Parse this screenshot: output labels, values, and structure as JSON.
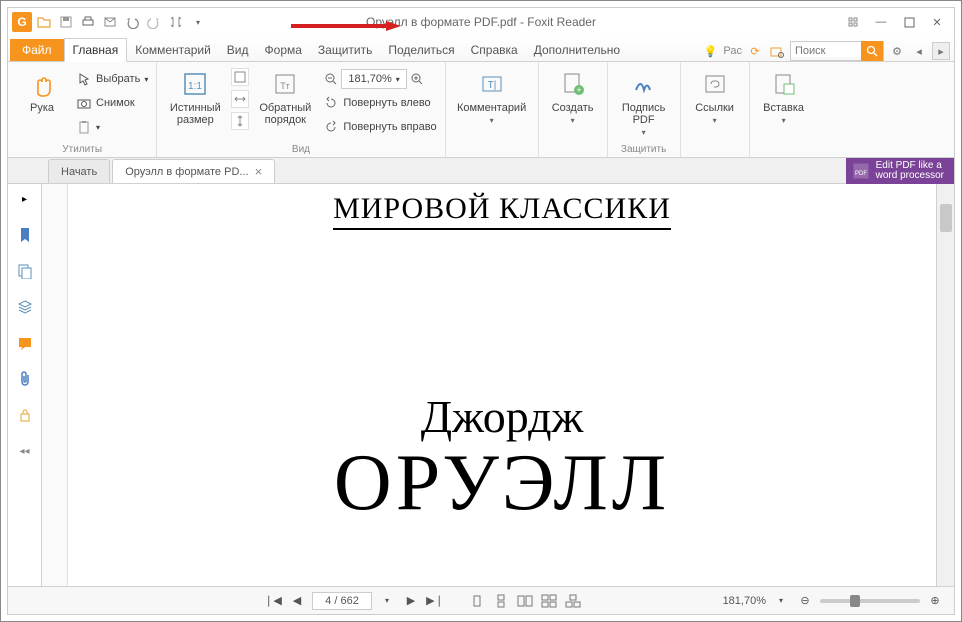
{
  "title": "Оруэлл в формате PDF.pdf - Foxit Reader",
  "qat": {
    "logo": "G"
  },
  "tabs": {
    "file": "Файл",
    "items": [
      "Главная",
      "Комментарий",
      "Вид",
      "Форма",
      "Защитить",
      "Поделиться",
      "Справка",
      "Дополнительно"
    ],
    "pac": "Рас",
    "search_placeholder": "Поиск"
  },
  "ribbon": {
    "utilities": {
      "hand": "Рука",
      "select": "Выбрать",
      "snapshot": "Снимок",
      "group": "Утилиты"
    },
    "view": {
      "fit": "Истинный\nразмер",
      "reflow": "Обратный\nпорядок",
      "zoom": "181,70%",
      "rotate_left": "Повернуть влево",
      "rotate_right": "Повернуть вправо",
      "group": "Вид"
    },
    "comment": {
      "label": "Комментарий"
    },
    "create": {
      "label": "Создать"
    },
    "protect": {
      "sign": "Подпись\nPDF",
      "group": "Защитить"
    },
    "links": {
      "label": "Ссылки"
    },
    "insert": {
      "label": "Вставка"
    }
  },
  "doctabs": {
    "start": "Начать",
    "doc": "Оруэлл в формате PD..."
  },
  "promo": {
    "line": "Edit PDF like a\nword processor"
  },
  "page_content": {
    "header": "МИРОВОЙ КЛАССИКИ",
    "author_first": "Джордж",
    "author_last": "ОРУЭЛЛ"
  },
  "status": {
    "page": "4 / 662",
    "zoom": "181,70%"
  }
}
